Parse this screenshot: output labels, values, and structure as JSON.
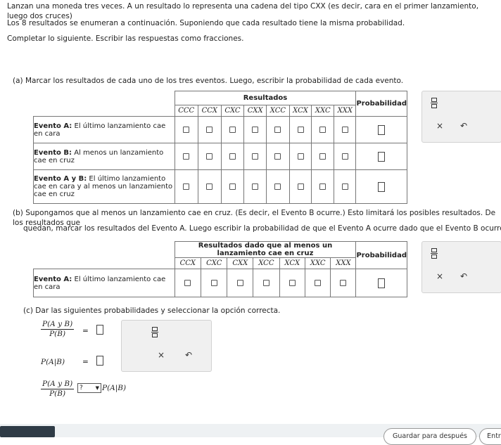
{
  "intro": {
    "line1": "Lanzan una moneda tres veces. A un resultado lo representa una cadena del tipo CXX (es decir, cara en el primer lanzamiento, luego dos cruces)",
    "line2": "Los 8 resultados se enumeran a continuación. Suponiendo que cada resultado tiene la misma probabilidad.",
    "line3": "Completar lo siguiente. Escribir las respuestas como fracciones."
  },
  "part_a": {
    "instruction": "(a) Marcar los resultados de cada uno de los tres eventos. Luego, escribir la probabilidad de cada evento.",
    "header_outcomes": "Resultados",
    "header_prob": "Probabilidad",
    "outcomes": [
      "CCC",
      "CCX",
      "CXC",
      "CXX",
      "XCC",
      "XCX",
      "XXC",
      "XXX"
    ],
    "rows": [
      {
        "name": "Evento A:",
        "desc": "El último lanzamiento cae en cara"
      },
      {
        "name": "Evento B:",
        "desc": "Al menos un lanzamiento cae en cruz"
      },
      {
        "name": "Evento A y B:",
        "desc": "El último lanzamiento cae en cara y al menos un lanzamiento cae en cruz"
      }
    ]
  },
  "part_b": {
    "instruction_1": "(b) Supongamos que al menos un lanzamiento cae en cruz. (Es decir, el Evento B ocurre.) Esto limitará los posibles resultados. De los resultados que",
    "instruction_2": "quedan, marcar los resultados del Evento A. Luego escribir la probabilidad de que el Evento A ocurre dado que el Evento B ocurre.",
    "header_outcomes": "Resultados dado que al menos un lanzamiento cae en cruz",
    "header_prob": "Probabilidad",
    "outcomes": [
      "CCX",
      "CXC",
      "CXX",
      "XCC",
      "XCX",
      "XXC",
      "XXX"
    ],
    "row": {
      "name": "Evento A:",
      "desc": "El último lanzamiento cae en cara"
    }
  },
  "part_c": {
    "instruction": "(c) Dar las siguientes probabilidades y seleccionar la opción correcta.",
    "frac_num": "P(A y B)",
    "frac_den": "P(B)",
    "equals": "=",
    "cond": "P(A|B)",
    "select_value": "?",
    "select_arrow": "▼"
  },
  "tools": {
    "clear": "×",
    "undo": "↶"
  },
  "footer": {
    "save_later": "Guardar para después",
    "submit": "Entr"
  }
}
